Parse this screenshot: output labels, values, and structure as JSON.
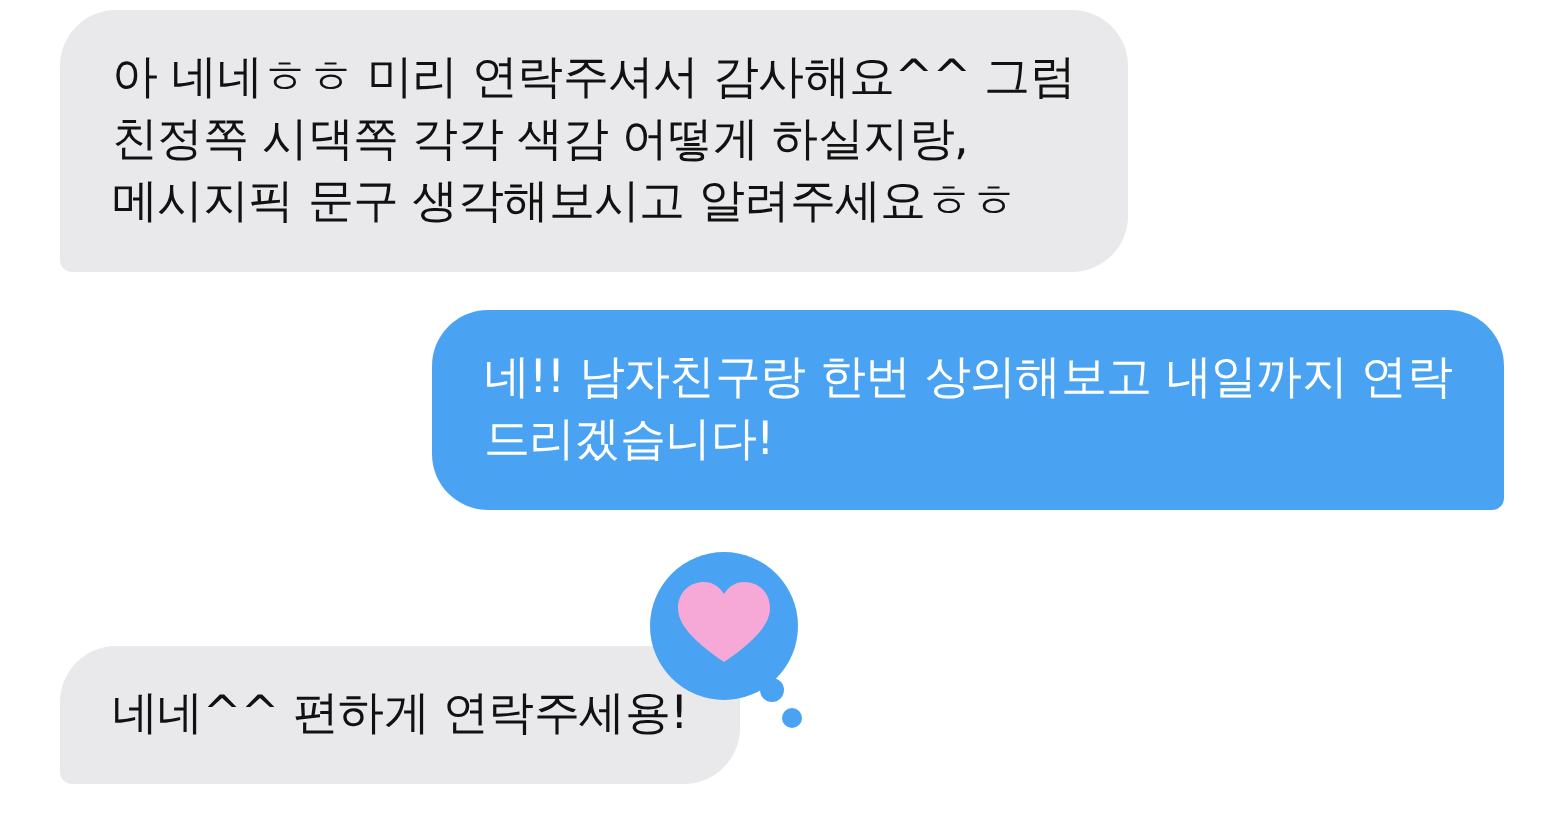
{
  "messages": [
    {
      "kind": "incoming",
      "text": "아 네네ㅎㅎ 미리 연락주셔서 감사해요^^ 그럼\n친정쪽 시댁쪽 각각 색감 어떻게 하실지랑,\n메시지픽 문구 생각해보시고 알려주세요ㅎㅎ"
    },
    {
      "kind": "outgoing",
      "text": "네!! 남자친구랑 한번 상의해보고 내일까지 연락\n드리겠습니다!"
    },
    {
      "kind": "incoming",
      "text": "네네^^ 편하게 연락주세용!",
      "hearted": true
    }
  ]
}
